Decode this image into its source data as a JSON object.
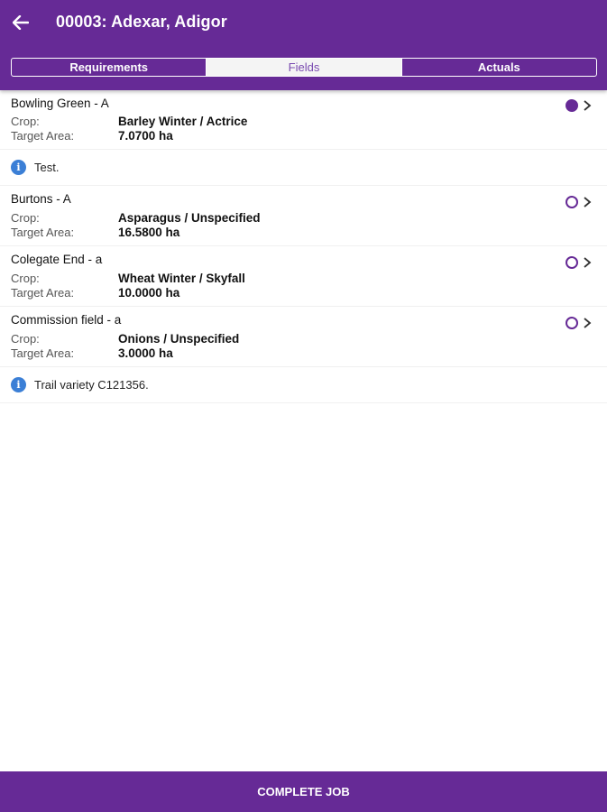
{
  "header": {
    "title": "00003: Adexar, Adigor",
    "back_icon": "arrow-left-icon"
  },
  "tabs": [
    {
      "label": "Requirements",
      "active": false
    },
    {
      "label": "Fields",
      "active": true
    },
    {
      "label": "Actuals",
      "active": false
    }
  ],
  "labels": {
    "crop": "Crop:",
    "target_area": "Target Area:"
  },
  "fields": [
    {
      "name": "Bowling Green - A",
      "crop": "Barley Winter / Actrice",
      "area": "7.0700 ha",
      "status": "filled"
    },
    {
      "name": "Burtons - A",
      "crop": "Asparagus / Unspecified",
      "area": "16.5800 ha",
      "status": "empty"
    },
    {
      "name": "Colegate End - a",
      "crop": "Wheat Winter / Skyfall",
      "area": "10.0000 ha",
      "status": "empty"
    },
    {
      "name": "Commission field - a",
      "crop": "Onions / Unspecified",
      "area": "3.0000 ha",
      "status": "empty"
    }
  ],
  "notes": [
    {
      "text": "Test.",
      "icon": "info-icon"
    },
    {
      "text": "Trail variety C121356.",
      "icon": "info-icon"
    }
  ],
  "footer": {
    "button_label": "COMPLETE JOB"
  },
  "colors": {
    "brand": "#662a96",
    "info": "#3b7fd6"
  }
}
